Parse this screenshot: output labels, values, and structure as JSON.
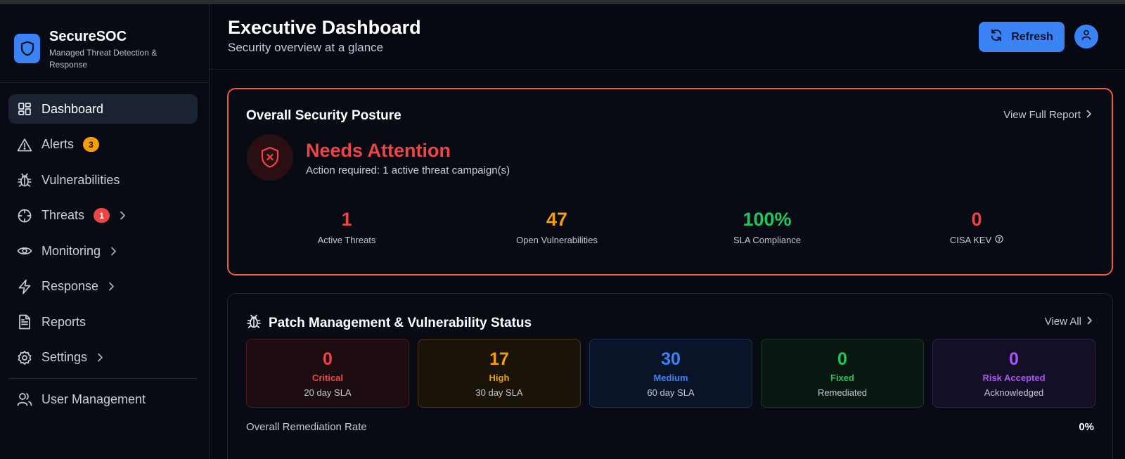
{
  "brand": {
    "name": "SecureSOC",
    "tagline": "Managed Threat Detection & Response"
  },
  "sidebar": {
    "items": [
      {
        "label": "Dashboard",
        "icon": "dashboard-grid-icon",
        "active": true
      },
      {
        "label": "Alerts",
        "icon": "warning-triangle-icon",
        "badge": "3"
      },
      {
        "label": "Vulnerabilities",
        "icon": "bug-icon"
      },
      {
        "label": "Threats",
        "icon": "crosshair-icon",
        "badge": "1",
        "expandable": true
      },
      {
        "label": "Monitoring",
        "icon": "eye-icon",
        "expandable": true
      },
      {
        "label": "Response",
        "icon": "lightning-icon",
        "expandable": true
      },
      {
        "label": "Reports",
        "icon": "document-icon"
      },
      {
        "label": "Settings",
        "icon": "gear-icon",
        "expandable": true
      },
      {
        "label": "User Management",
        "icon": "users-icon"
      }
    ]
  },
  "header": {
    "title": "Executive Dashboard",
    "subtitle": "Security overview at a glance",
    "refresh_label": "Refresh"
  },
  "posture": {
    "title": "Overall Security Posture",
    "link": "View Full Report",
    "status": "Needs Attention",
    "status_detail": "Action required: 1 active threat campaign(s)",
    "metrics": [
      {
        "value": "1",
        "label": "Active Threats",
        "color": "#ef4444"
      },
      {
        "value": "47",
        "label": "Open Vulnerabilities",
        "color": "#f59e0b"
      },
      {
        "value": "100%",
        "label": "SLA Compliance",
        "color": "#22c55e"
      },
      {
        "value": "0",
        "label": "CISA KEV",
        "color": "#ef4444"
      }
    ]
  },
  "patch": {
    "title": "Patch Management & Vulnerability Status",
    "link": "View All",
    "tiles": [
      {
        "value": "0",
        "label": "Critical",
        "sub": "20 day SLA",
        "color": "#ef4444",
        "bg": "#1c0c10",
        "border": "#4a1c20"
      },
      {
        "value": "17",
        "label": "High",
        "sub": "30 day SLA",
        "color": "#f59e0b",
        "bg": "#1a1308",
        "border": "#4e3711"
      },
      {
        "value": "30",
        "label": "Medium",
        "sub": "60 day SLA",
        "color": "#3b82f6",
        "bg": "#0a1428",
        "border": "#1d3157"
      },
      {
        "value": "0",
        "label": "Fixed",
        "sub": "Remediated",
        "color": "#22c55e",
        "bg": "#08170f",
        "border": "#183a24"
      },
      {
        "value": "0",
        "label": "Risk Accepted",
        "sub": "Acknowledged",
        "color": "#a855f7",
        "bg": "#140f26",
        "border": "#2f2550"
      }
    ],
    "rate_label": "Overall Remediation Rate",
    "rate_value": "0%"
  }
}
